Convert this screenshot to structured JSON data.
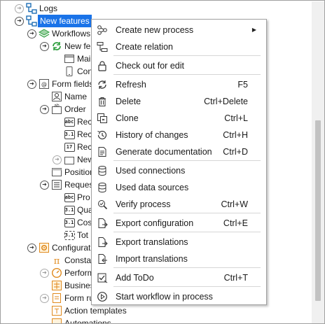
{
  "tree": {
    "logs": "Logs",
    "new_features": "New features",
    "workflows": "Workflows",
    "new_fe": "New fe",
    "mai": "Mai",
    "con": "Con",
    "form_fields": "Form fields",
    "name": "Name",
    "order": "Order",
    "rec1": "Rec",
    "rec2": "Rec",
    "rec3": "Rec",
    "new": "New",
    "position": "Position",
    "reques": "Reques",
    "pro": "Pro",
    "qua": "Qua",
    "cos": "Cos",
    "tot": "Tot",
    "configuration": "Configuration",
    "consta": "Consta",
    "perform": "Perform",
    "busines": "Busines",
    "form_ru": "Form ru",
    "action_templates": "Action templates",
    "automations": "Automations"
  },
  "badges": {
    "abc": "abc",
    "num": "3.1",
    "date": "17",
    "ab": "ab"
  },
  "menu": [
    {
      "icon": "create-process-icon",
      "label": "Create new process",
      "shortcut": "",
      "submenu": true
    },
    {
      "icon": "create-relation-icon",
      "label": "Create relation",
      "shortcut": ""
    },
    {
      "icon": "lock-icon",
      "label": "Check out for edit",
      "shortcut": ""
    },
    {
      "icon": "refresh-icon",
      "label": "Refresh",
      "shortcut": "F5"
    },
    {
      "icon": "trash-icon",
      "label": "Delete",
      "shortcut": "Ctrl+Delete"
    },
    {
      "icon": "clone-icon",
      "label": "Clone",
      "shortcut": "Ctrl+L"
    },
    {
      "icon": "history-icon",
      "label": "History of changes",
      "shortcut": "Ctrl+H"
    },
    {
      "icon": "document-icon",
      "label": "Generate documentation",
      "shortcut": "Ctrl+D"
    },
    {
      "icon": "database-icon",
      "label": "Used connections",
      "shortcut": ""
    },
    {
      "icon": "database-icon",
      "label": "Used data sources",
      "shortcut": ""
    },
    {
      "icon": "verify-icon",
      "label": "Verify process",
      "shortcut": "Ctrl+W"
    },
    {
      "icon": "export-icon",
      "label": "Export configuration",
      "shortcut": "Ctrl+E"
    },
    {
      "icon": "export-icon",
      "label": "Export translations",
      "shortcut": ""
    },
    {
      "icon": "import-icon",
      "label": "Import translations",
      "shortcut": ""
    },
    {
      "icon": "todo-icon",
      "label": "Add ToDo",
      "shortcut": "Ctrl+T"
    },
    {
      "icon": "play-icon",
      "label": "Start workflow in process",
      "shortcut": ""
    }
  ],
  "colors": {
    "selection": "#1a73e8",
    "accent_blue": "#1f6fb5",
    "accent_green": "#2e9e3e",
    "accent_orange": "#e08a1e"
  }
}
